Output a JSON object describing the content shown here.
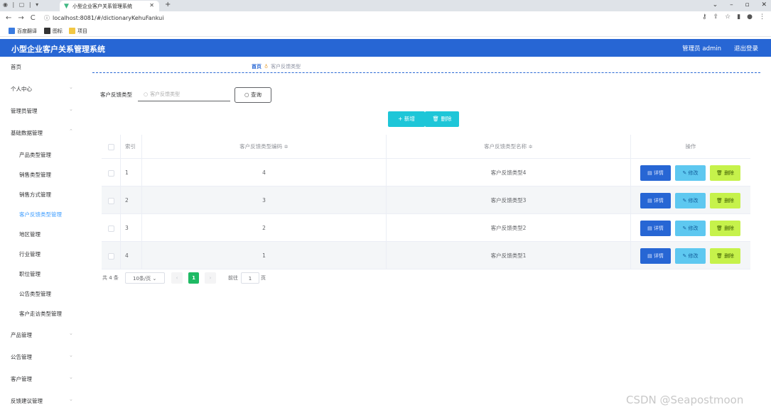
{
  "browser": {
    "tab_title": "小型企业客户关系管理系统",
    "url": "localhost:8081/#/dictionaryKehuFankui",
    "bookmarks": [
      "百度翻译",
      "图标",
      "项目"
    ]
  },
  "header": {
    "title": "小型企业客户关系管理系统",
    "user": "管理员 admin",
    "logout": "退出登录"
  },
  "sidebar": {
    "items": [
      {
        "label": "首页",
        "sub": false,
        "expandable": false
      },
      {
        "label": "个人中心",
        "sub": false,
        "expandable": true
      },
      {
        "label": "管理员管理",
        "sub": false,
        "expandable": true
      },
      {
        "label": "基础数据管理",
        "sub": false,
        "expandable": true
      },
      {
        "label": "产品类型管理",
        "sub": true
      },
      {
        "label": "销售类型管理",
        "sub": true
      },
      {
        "label": "销售方式管理",
        "sub": true
      },
      {
        "label": "客户反馈类型管理",
        "sub": true,
        "active": true
      },
      {
        "label": "地区管理",
        "sub": true
      },
      {
        "label": "行业管理",
        "sub": true
      },
      {
        "label": "职位管理",
        "sub": true
      },
      {
        "label": "公告类型管理",
        "sub": true
      },
      {
        "label": "客户走访类型管理",
        "sub": true
      },
      {
        "label": "产品管理",
        "sub": false,
        "expandable": true
      },
      {
        "label": "公告管理",
        "sub": false,
        "expandable": true
      },
      {
        "label": "客户管理",
        "sub": false,
        "expandable": true
      },
      {
        "label": "反馈建议管理",
        "sub": false,
        "expandable": true
      }
    ]
  },
  "breadcrumb": {
    "home": "首页",
    "current": "客户反馈类型"
  },
  "search": {
    "label": "客户反馈类型",
    "placeholder": "客户反馈类型",
    "button": "查询"
  },
  "actions": {
    "add": "+ 新增",
    "delete": "删除"
  },
  "table": {
    "headers": {
      "index": "索引",
      "code": "客户反馈类型编码 ≑",
      "name": "客户反馈类型名称 ≑",
      "ops": "操作"
    },
    "rows": [
      {
        "index": "1",
        "code": "4",
        "name": "客户反馈类型4"
      },
      {
        "index": "2",
        "code": "3",
        "name": "客户反馈类型3"
      },
      {
        "index": "3",
        "code": "2",
        "name": "客户反馈类型2"
      },
      {
        "index": "4",
        "code": "1",
        "name": "客户反馈类型1"
      }
    ],
    "op_labels": {
      "detail": "详情",
      "edit": "修改",
      "delete": "删除"
    }
  },
  "pagination": {
    "total": "共 4 条",
    "page_size": "10条/页",
    "current": "1",
    "goto": "前往",
    "goto_value": "1",
    "unit": "页"
  },
  "watermark": "CSDN @Seapostmoon",
  "colors": {
    "primary": "#2766d4",
    "teal": "#1ec6d8",
    "edit": "#5ec8f0",
    "delete": "#c6f24b",
    "pager_active": "#1fba64"
  }
}
